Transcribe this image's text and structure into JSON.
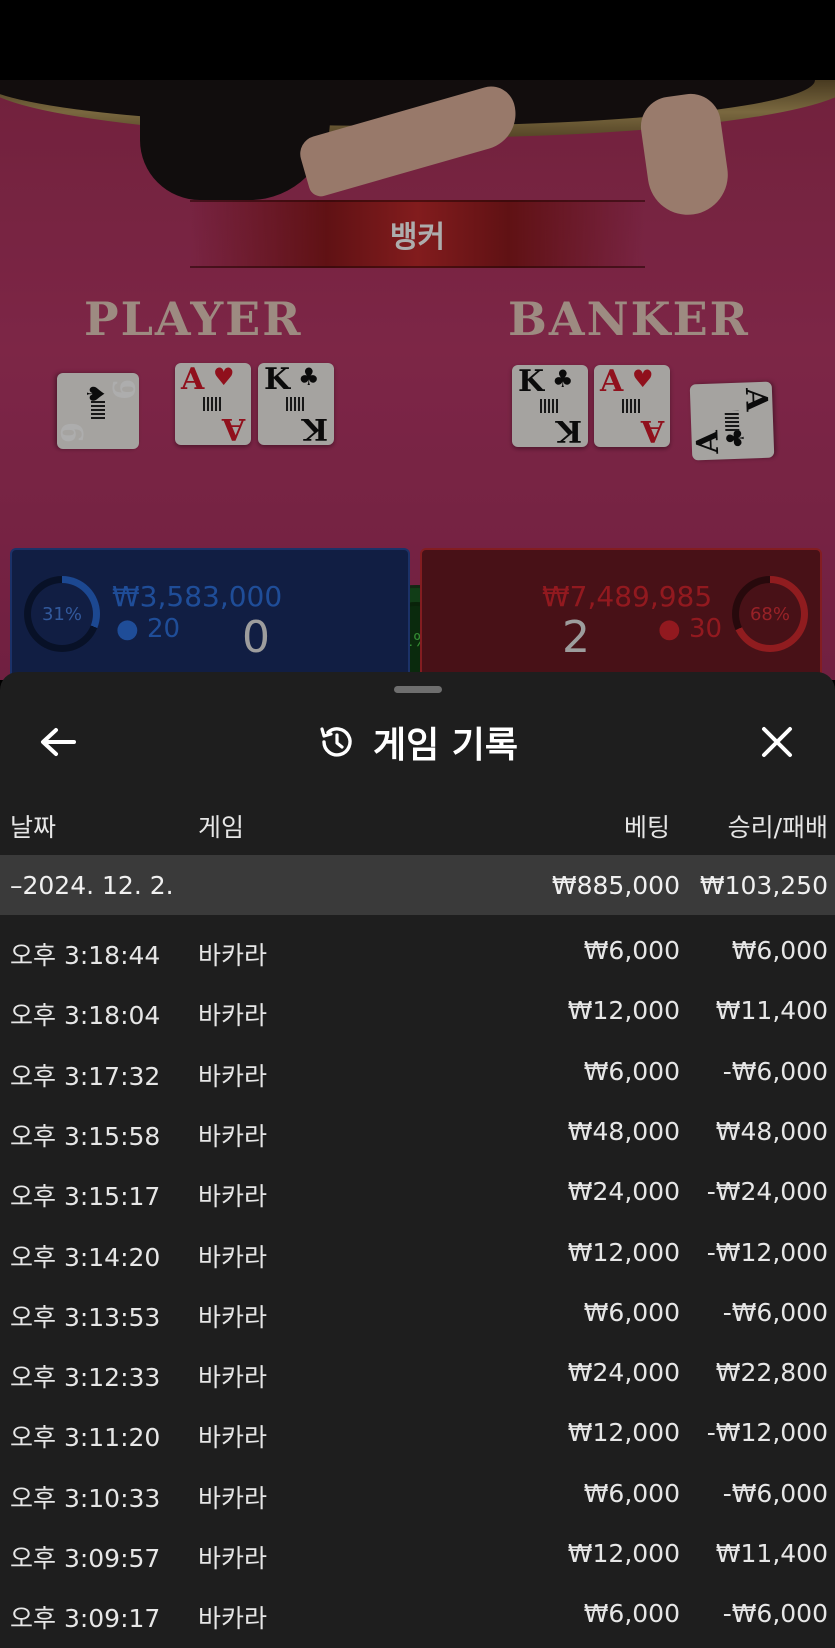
{
  "table": {
    "result_label": "뱅커",
    "player_title": "PLAYER",
    "banker_title": "BANKER",
    "player_cards": [
      {
        "rank": "9",
        "suit": "♠",
        "color": "black"
      },
      {
        "rank": "A",
        "suit": "♥",
        "color": "red"
      },
      {
        "rank": "K",
        "suit": "♣",
        "color": "black"
      }
    ],
    "banker_cards": [
      {
        "rank": "K",
        "suit": "♣",
        "color": "black"
      },
      {
        "rank": "A",
        "suit": "♥",
        "color": "red"
      },
      {
        "rank": "A",
        "suit": "♣",
        "color": "black"
      }
    ],
    "player": {
      "percent": "31%",
      "percent_value": 31,
      "amount": "₩3,583,000",
      "count": "20",
      "score": "0"
    },
    "tie": {
      "percent": "1%",
      "percent_value": 1
    },
    "banker": {
      "percent": "68%",
      "percent_value": 68,
      "amount": "₩7,489,985",
      "count": "30",
      "score": "2"
    },
    "colors": {
      "player": "#2a6ad6",
      "banker": "#d42a2e",
      "tie": "#3cc43c"
    }
  },
  "sheet": {
    "title": "게임 기록",
    "columns": {
      "date": "날짜",
      "game": "게임",
      "bet": "베팅",
      "winloss": "승리/패배"
    },
    "date_group": {
      "label": "–2024. 12. 2.",
      "bet_total": "₩885,000",
      "winloss_total": "₩103,250"
    },
    "rows": [
      {
        "time": "오후 3:18:44",
        "game": "바카라",
        "bet": "₩6,000",
        "winloss": "₩6,000"
      },
      {
        "time": "오후 3:18:04",
        "game": "바카라",
        "bet": "₩12,000",
        "winloss": "₩11,400"
      },
      {
        "time": "오후 3:17:32",
        "game": "바카라",
        "bet": "₩6,000",
        "winloss": "-₩6,000"
      },
      {
        "time": "오후 3:15:58",
        "game": "바카라",
        "bet": "₩48,000",
        "winloss": "₩48,000"
      },
      {
        "time": "오후 3:15:17",
        "game": "바카라",
        "bet": "₩24,000",
        "winloss": "-₩24,000"
      },
      {
        "time": "오후 3:14:20",
        "game": "바카라",
        "bet": "₩12,000",
        "winloss": "-₩12,000"
      },
      {
        "time": "오후 3:13:53",
        "game": "바카라",
        "bet": "₩6,000",
        "winloss": "-₩6,000"
      },
      {
        "time": "오후 3:12:33",
        "game": "바카라",
        "bet": "₩24,000",
        "winloss": "₩22,800"
      },
      {
        "time": "오후 3:11:20",
        "game": "바카라",
        "bet": "₩12,000",
        "winloss": "-₩12,000"
      },
      {
        "time": "오후 3:10:33",
        "game": "바카라",
        "bet": "₩6,000",
        "winloss": "-₩6,000"
      },
      {
        "time": "오후 3:09:57",
        "game": "바카라",
        "bet": "₩12,000",
        "winloss": "₩11,400"
      },
      {
        "time": "오후 3:09:17",
        "game": "바카라",
        "bet": "₩6,000",
        "winloss": "-₩6,000"
      }
    ]
  },
  "icons": {
    "back": "arrow-left-icon",
    "history": "history-icon",
    "close": "close-icon",
    "person": "person-icon"
  }
}
